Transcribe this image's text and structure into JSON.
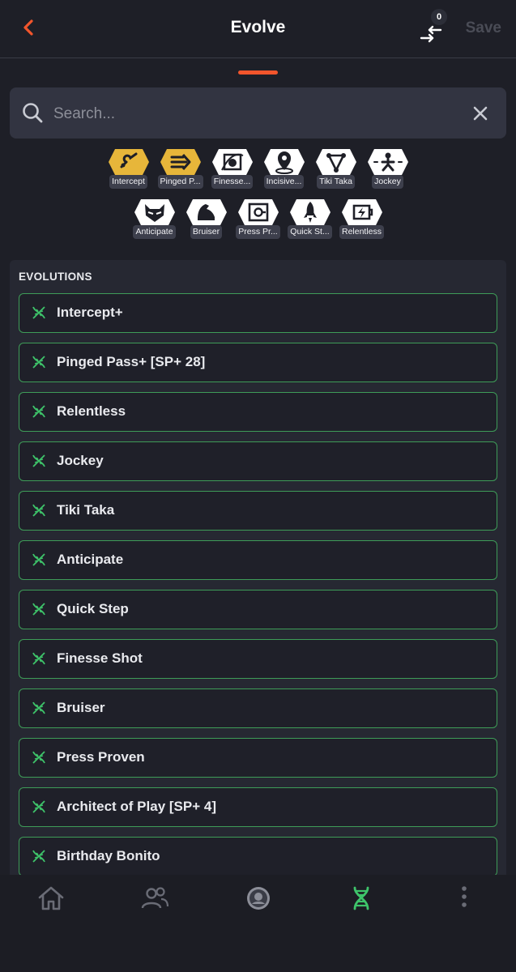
{
  "header": {
    "title": "Evolve",
    "save_label": "Save",
    "swap_count": "0"
  },
  "search": {
    "placeholder": "Search..."
  },
  "chips": [
    {
      "label": "Intercept",
      "icon": "intercept-icon",
      "active": true
    },
    {
      "label": "Pinged P...",
      "icon": "pinged-pass-icon",
      "active": true
    },
    {
      "label": "Finesse...",
      "icon": "finesse-shot-icon",
      "active": false
    },
    {
      "label": "Incisive...",
      "icon": "incisive-pass-icon",
      "active": false
    },
    {
      "label": "Tiki Taka",
      "icon": "tiki-taka-icon",
      "active": false
    },
    {
      "label": "Jockey",
      "icon": "jockey-icon",
      "active": false
    },
    {
      "label": "Anticipate",
      "icon": "anticipate-icon",
      "active": false
    },
    {
      "label": "Bruiser",
      "icon": "bruiser-icon",
      "active": false
    },
    {
      "label": "Press Pr...",
      "icon": "press-proven-icon",
      "active": false
    },
    {
      "label": "Quick St...",
      "icon": "quick-step-icon",
      "active": false
    },
    {
      "label": "Relentless",
      "icon": "relentless-icon",
      "active": false
    }
  ],
  "evolutions": {
    "heading": "EVOLUTIONS",
    "items": [
      "Intercept+",
      "Pinged Pass+ [SP+ 28]",
      "Relentless",
      "Jockey",
      "Tiki Taka",
      "Anticipate",
      "Quick Step",
      "Finesse Shot",
      "Bruiser",
      "Press Proven",
      "Architect of Play [SP+ 4]",
      "Birthday Bonito"
    ]
  },
  "bottom_nav": [
    {
      "name": "home-icon",
      "active": false
    },
    {
      "name": "players-icon",
      "active": false
    },
    {
      "name": "club-badge-icon",
      "active": false
    },
    {
      "name": "dna-icon",
      "active": true
    },
    {
      "name": "more-vertical-icon",
      "active": false
    }
  ],
  "colors": {
    "background": "#1e1f27",
    "accent": "#f2552c",
    "evolution_border": "#3e9c58",
    "chip_gold": "#e7b63a",
    "nav_active": "#3ec46a"
  }
}
